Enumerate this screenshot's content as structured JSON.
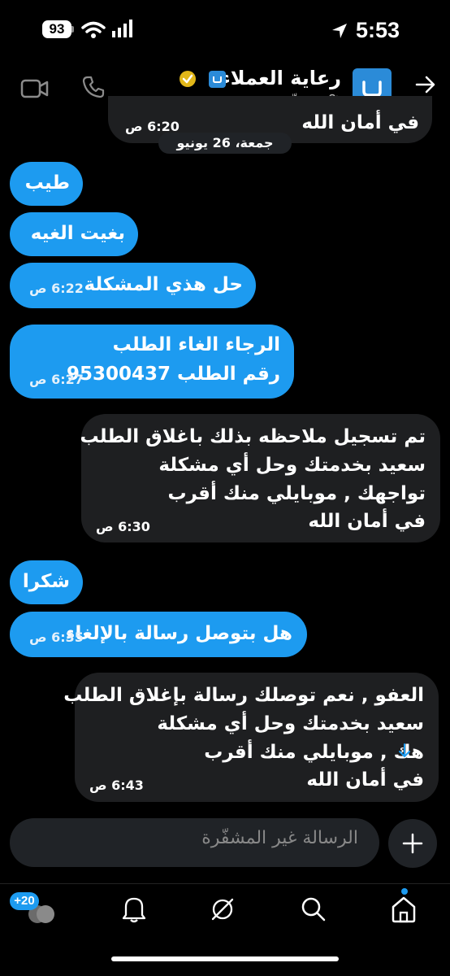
{
  "status_bar": {
    "time": "5:53",
    "battery": "93"
  },
  "header": {
    "title": "رعاية العملاء",
    "subtitle": "غير مشفّرة",
    "icons": [
      "back-arrow-icon",
      "lock-icon",
      "verified-badge-icon",
      "video-call-icon",
      "phone-call-icon"
    ]
  },
  "conversation": {
    "top_partial_text": "في أمان الله",
    "top_partial_time": "6:20 ص",
    "date_separator": "جمعة، 26 يونيو",
    "messages": [
      {
        "direction": "out",
        "lines": [
          "طيب"
        ],
        "time": ""
      },
      {
        "direction": "out",
        "lines": [
          "بغيت الغيه"
        ],
        "time": ""
      },
      {
        "direction": "out",
        "lines": [
          "حل هذي المشكلة"
        ],
        "time": "6:22 ص"
      },
      {
        "direction": "out",
        "lines": [
          "الرجاء الغاء الطلب",
          "رقم الطلب 95300437"
        ],
        "time": "6:27 ص"
      },
      {
        "direction": "in",
        "lines": [
          "تم تسجيل ملاحظه بذلك باغلاق الطلب",
          "سعيد بخدمتك وحل أي مشكلة",
          "تواجهك , موبايلي منك أقرب",
          "في أمان الله"
        ],
        "time": "6:30 ص"
      },
      {
        "direction": "out",
        "lines": [
          "شكرا"
        ],
        "time": ""
      },
      {
        "direction": "out",
        "lines": [
          "هل بتوصل رسالة بالإلغاء"
        ],
        "time": "6:35 ص"
      },
      {
        "direction": "in",
        "lines": [
          "العفو , نعم توصلك رسالة بإغلاق الطلب",
          "سعيد بخدمتك وحل أي مشكلة",
          "هك , موبايلي منك أقرب",
          "في أمان الله"
        ],
        "time": "6:43 ص"
      }
    ]
  },
  "composer": {
    "placeholder": "الرسالة غير المشفّرة"
  },
  "tab_bar": {
    "badge": "+20",
    "tabs": [
      "home-icon",
      "search-icon",
      "grok-icon",
      "bell-icon",
      "messages-icon"
    ]
  },
  "colors": {
    "accent": "#1d9bf0",
    "incoming_bubble": "#1e1f21",
    "background": "#000000"
  }
}
